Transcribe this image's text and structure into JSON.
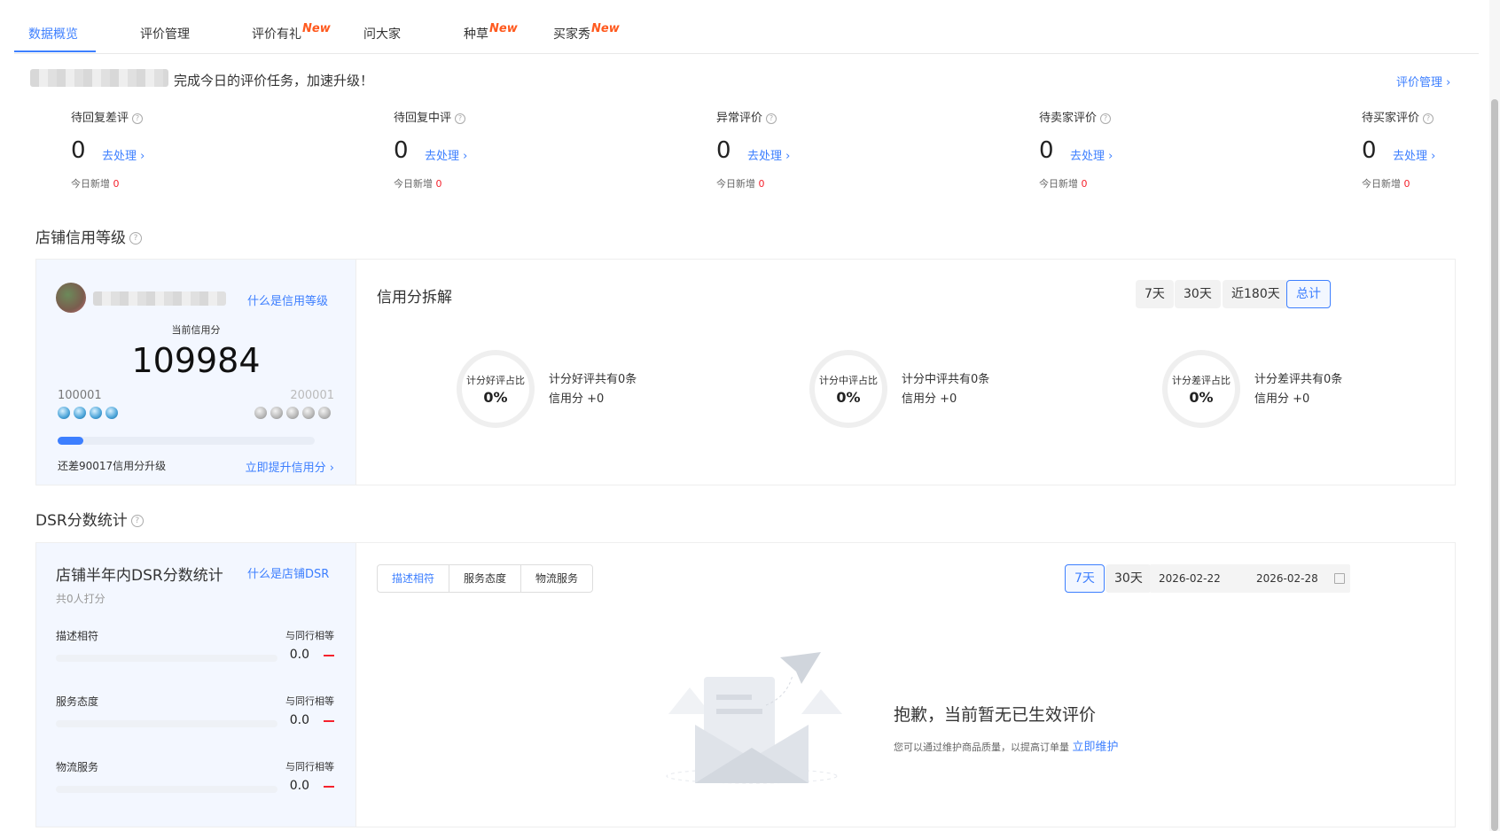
{
  "tabs": [
    {
      "label": "数据概览",
      "badge": ""
    },
    {
      "label": "评价管理",
      "badge": ""
    },
    {
      "label": "评价有礼",
      "badge": "New"
    },
    {
      "label": "问大家",
      "badge": ""
    },
    {
      "label": "种草",
      "badge": "New"
    },
    {
      "label": "买家秀",
      "badge": "New"
    }
  ],
  "greeting": {
    "text": "完成今日的评价任务，加速升级！",
    "link": "评价管理 ›"
  },
  "stats": [
    {
      "label": "待回复差评",
      "value": "0",
      "action": "去处理 ›",
      "new_label": "今日新增",
      "new_value": "0"
    },
    {
      "label": "待回复中评",
      "value": "0",
      "action": "去处理 ›",
      "new_label": "今日新增",
      "new_value": "0"
    },
    {
      "label": "异常评价",
      "value": "0",
      "action": "去处理 ›",
      "new_label": "今日新增",
      "new_value": "0"
    },
    {
      "label": "待卖家评价",
      "value": "0",
      "action": "去处理 ›",
      "new_label": "今日新增",
      "new_value": "0"
    },
    {
      "label": "待买家评价",
      "value": "0",
      "action": "去处理 ›",
      "new_label": "今日新增",
      "new_value": "0"
    }
  ],
  "credit": {
    "section_title": "店铺信用等级",
    "what_link": "什么是信用等级",
    "current_label": "当前信用分",
    "score": "109984",
    "level_low": "100001",
    "level_high": "200001",
    "progress_fraction": 0.1,
    "remain_text": "还差90017信用分升级",
    "boost_link": "立即提升信用分 ›",
    "breakdown_title": "信用分拆解",
    "periods": [
      "7天",
      "30天",
      "近180天",
      "总计"
    ],
    "selected_period": "总计",
    "rings": [
      {
        "label": "计分好评占比",
        "pct": "0%",
        "line1": "计分好评共有0条",
        "line2": "信用分 +0"
      },
      {
        "label": "计分中评占比",
        "pct": "0%",
        "line1": "计分中评共有0条",
        "line2": "信用分 +0"
      },
      {
        "label": "计分差评占比",
        "pct": "0%",
        "line1": "计分差评共有0条",
        "line2": "信用分 +0"
      }
    ]
  },
  "dsr": {
    "section_title": "DSR分数统计",
    "panel_title": "店铺半年内DSR分数统计",
    "what_link": "什么是店铺DSR",
    "count": "共0人打分",
    "rows": [
      {
        "name": "描述相符",
        "compare": "与同行相等",
        "score": "0.0"
      },
      {
        "name": "服务态度",
        "compare": "与同行相等",
        "score": "0.0"
      },
      {
        "name": "物流服务",
        "compare": "与同行相等",
        "score": "0.0"
      }
    ],
    "segments": [
      "描述相符",
      "服务态度",
      "物流服务"
    ],
    "periods": [
      "7天",
      "30天"
    ],
    "date_start": "2026-02-22",
    "date_end": "2026-02-28",
    "empty_title": "抱歉，当前暂无已生效评价",
    "empty_desc": "您可以通过维护商品质量，以提高订单量",
    "empty_link": "立即维护"
  },
  "colors": {
    "accent": "#3d7fff",
    "danger": "#f5222d",
    "badge": "#ff5a1f"
  }
}
